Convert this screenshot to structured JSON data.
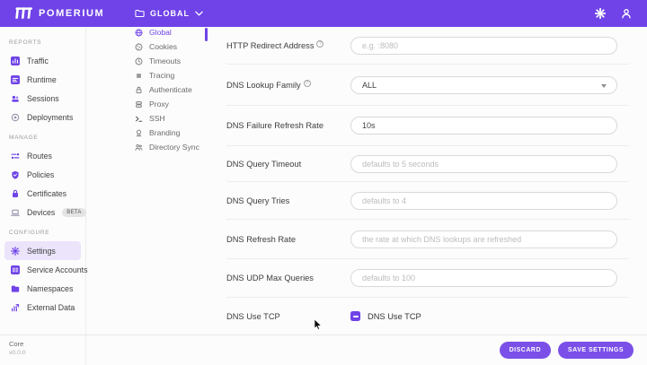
{
  "colors": {
    "brand": "#6F43E7",
    "button": "#7A50E8",
    "active_item_bg": "#EBE4FB"
  },
  "header": {
    "brand": "POMERIUM",
    "namespace": "GLOBAL"
  },
  "ui": {
    "help_glyph": "?"
  },
  "sidebar": {
    "sections": [
      {
        "label": "REPORTS",
        "items": [
          {
            "label": "Traffic"
          },
          {
            "label": "Runtime"
          },
          {
            "label": "Sessions"
          },
          {
            "label": "Deployments"
          }
        ]
      },
      {
        "label": "MANAGE",
        "items": [
          {
            "label": "Routes"
          },
          {
            "label": "Policies"
          },
          {
            "label": "Certificates"
          },
          {
            "label": "Devices",
            "badge": "BETA"
          }
        ]
      },
      {
        "label": "CONFIGURE",
        "items": [
          {
            "label": "Settings",
            "active": true
          },
          {
            "label": "Service Accounts"
          },
          {
            "label": "Namespaces"
          },
          {
            "label": "External Data"
          }
        ]
      }
    ],
    "footer": {
      "product": "Core",
      "version": "v0.0.0"
    }
  },
  "settings_nav": {
    "items": [
      {
        "label": "Global",
        "active": true
      },
      {
        "label": "Cookies"
      },
      {
        "label": "Timeouts"
      },
      {
        "label": "Tracing"
      },
      {
        "label": "Authenticate"
      },
      {
        "label": "Proxy"
      },
      {
        "label": "SSH"
      },
      {
        "label": "Branding"
      },
      {
        "label": "Directory Sync"
      }
    ]
  },
  "form": {
    "rows": [
      {
        "label": "HTTP Redirect Address",
        "control": "input",
        "placeholder": "e.g. :8080"
      },
      {
        "label": "DNS Lookup Family",
        "control": "select",
        "value": "ALL"
      },
      {
        "label": "DNS Failure Refresh Rate",
        "control": "input",
        "value": "10s"
      },
      {
        "label": "DNS Query Timeout",
        "control": "input",
        "placeholder": "defaults to 5 seconds"
      },
      {
        "label": "DNS Query Tries",
        "control": "input",
        "placeholder": "defaults to 4"
      },
      {
        "label": "DNS Refresh Rate",
        "control": "input",
        "placeholder": "the rate at which DNS lookups are refreshed"
      },
      {
        "label": "DNS UDP Max Queries",
        "control": "input",
        "placeholder": "defaults to 100"
      },
      {
        "label": "DNS Use TCP",
        "control": "checkbox",
        "checkbox_label": "DNS Use TCP",
        "checked": true
      }
    ]
  },
  "footer_bar": {
    "discard_label": "DISCARD",
    "save_label": "SAVE SETTINGS"
  }
}
